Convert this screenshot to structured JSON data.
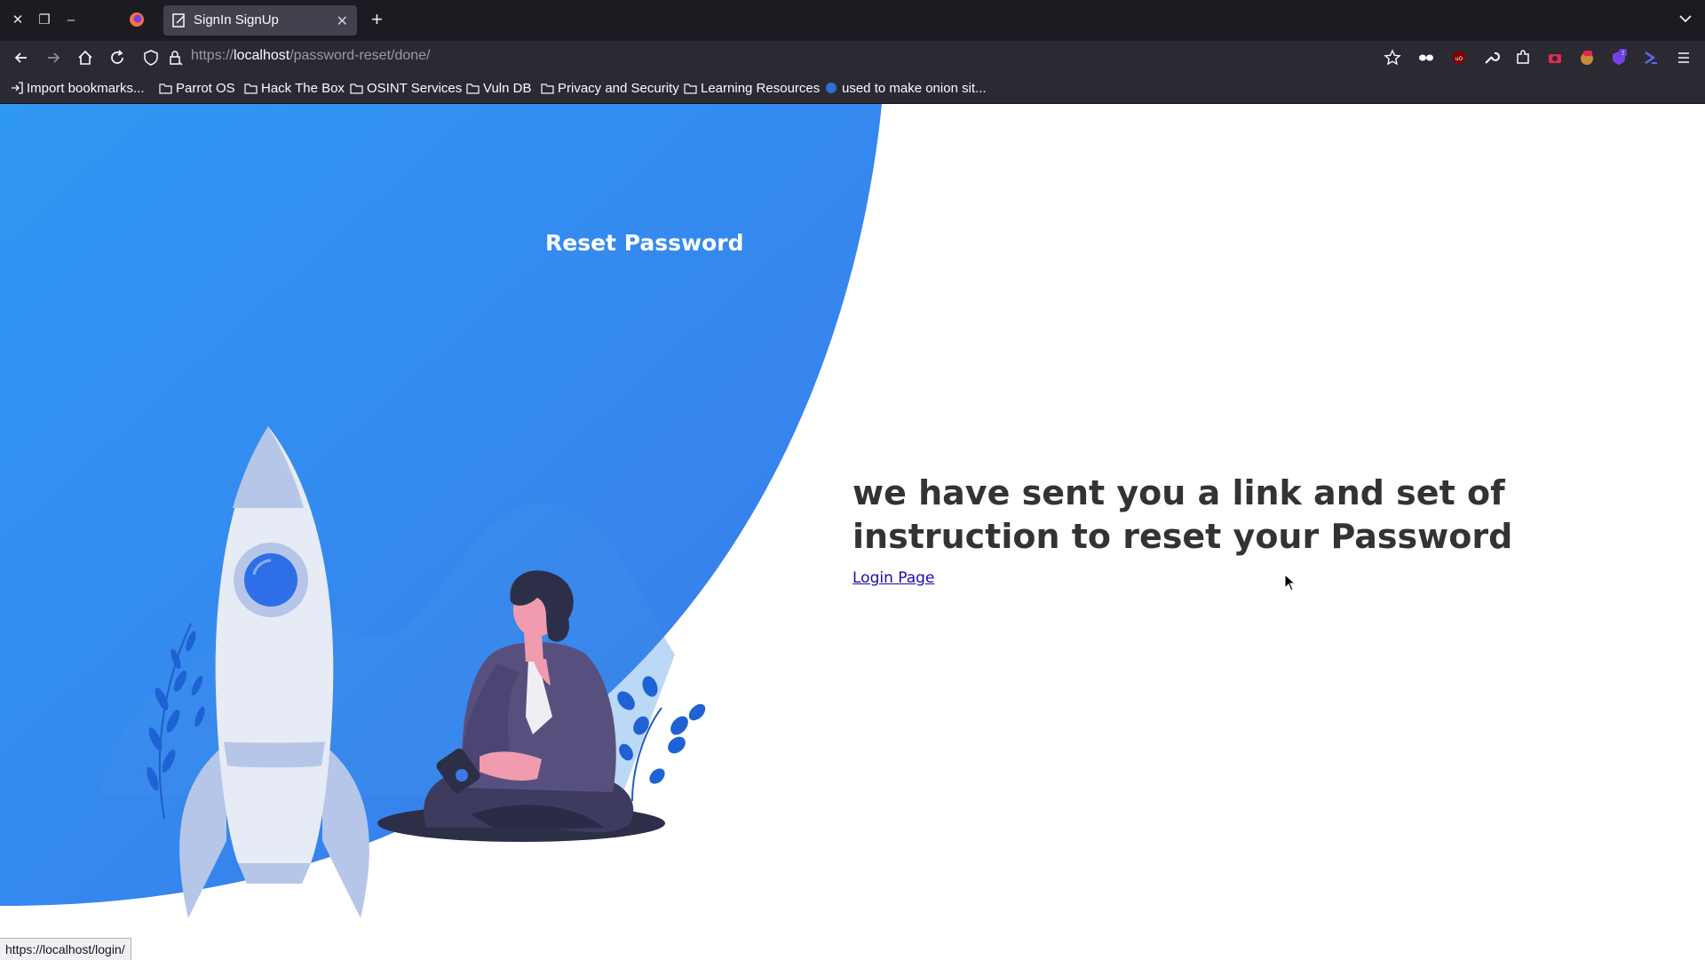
{
  "browser": {
    "tab": {
      "title": "SignIn SignUp"
    },
    "address_bar": {
      "scheme": "https://",
      "host": "localhost",
      "path": "/password-reset/done/"
    },
    "bookmarks": [
      {
        "label": "Import bookmarks...",
        "icon": "import-icon"
      },
      {
        "label": "Parrot OS",
        "icon": "folder-icon"
      },
      {
        "label": "Hack The Box",
        "icon": "folder-icon"
      },
      {
        "label": "OSINT Services",
        "icon": "folder-icon"
      },
      {
        "label": "Vuln DB",
        "icon": "folder-icon"
      },
      {
        "label": "Privacy and Security",
        "icon": "folder-icon"
      },
      {
        "label": "Learning Resources",
        "icon": "folder-icon"
      },
      {
        "label": "used to make onion sit...",
        "icon": "globe-icon"
      }
    ],
    "extension_badge": "2",
    "status_url": "https://localhost/login/"
  },
  "page": {
    "panel_title": "Reset Password",
    "message": "we have sent you a link and set of instruction to reset your Password",
    "login_link": "Login Page"
  },
  "colors": {
    "blob_start": "#2f98f3",
    "blob_end": "#3a79ea",
    "heading_text": "#333333",
    "link": "#1a0dab"
  }
}
